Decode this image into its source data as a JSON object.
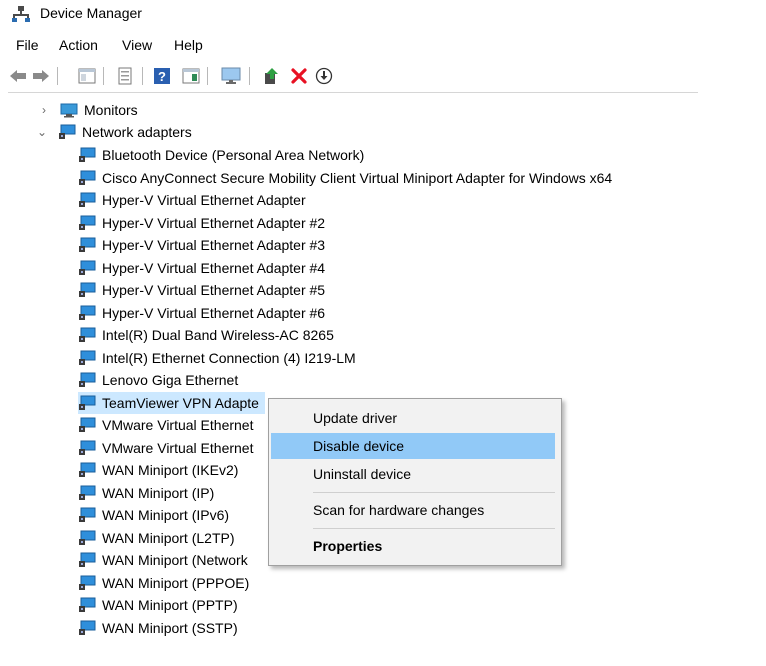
{
  "window": {
    "title": "Device Manager"
  },
  "menubar": [
    {
      "label": "File"
    },
    {
      "label": "Action"
    },
    {
      "label": "View"
    },
    {
      "label": "Help"
    }
  ],
  "toolbar": [
    {
      "icon": "back-arrow-icon"
    },
    {
      "icon": "forward-arrow-icon"
    },
    {
      "icon": "show-hide-console-tree-icon"
    },
    {
      "icon": "properties-icon"
    },
    {
      "icon": "help-icon"
    },
    {
      "icon": "action-pane-icon"
    },
    {
      "icon": "computer-monitor-icon"
    },
    {
      "icon": "update-driver-icon"
    },
    {
      "icon": "uninstall-x-icon"
    },
    {
      "icon": "download-circle-icon"
    }
  ],
  "tree": {
    "monitors": {
      "label": "Monitors",
      "expanded": false
    },
    "network_adapters": {
      "label": "Network adapters",
      "expanded": true,
      "children": [
        "Bluetooth Device (Personal Area Network)",
        "Cisco AnyConnect Secure Mobility Client Virtual Miniport Adapter for Windows x64",
        "Hyper-V Virtual Ethernet Adapter",
        "Hyper-V Virtual Ethernet Adapter #2",
        "Hyper-V Virtual Ethernet Adapter #3",
        "Hyper-V Virtual Ethernet Adapter #4",
        "Hyper-V Virtual Ethernet Adapter #5",
        "Hyper-V Virtual Ethernet Adapter #6",
        "Intel(R) Dual Band Wireless-AC 8265",
        "Intel(R) Ethernet Connection (4) I219-LM",
        "Lenovo Giga Ethernet",
        "TeamViewer VPN Adapte",
        "VMware Virtual Ethernet",
        "VMware Virtual Ethernet",
        "WAN Miniport (IKEv2)",
        "WAN Miniport (IP)",
        "WAN Miniport (IPv6)",
        "WAN Miniport (L2TP)",
        "WAN Miniport (Network",
        "WAN Miniport (PPPOE)",
        "WAN Miniport (PPTP)",
        "WAN Miniport (SSTP)"
      ],
      "selected_index": 11
    }
  },
  "context_menu": {
    "items": [
      {
        "label": "Update driver",
        "highlighted": false,
        "bold": false
      },
      {
        "label": "Disable device",
        "highlighted": true,
        "bold": false
      },
      {
        "label": "Uninstall device",
        "highlighted": false,
        "bold": false
      },
      {
        "label": "Scan for hardware changes",
        "highlighted": false,
        "bold": false
      },
      {
        "label": "Properties",
        "highlighted": false,
        "bold": true
      }
    ]
  },
  "colors": {
    "selection": "#cce8ff",
    "menu_highlight": "#91c9f7",
    "menu_bg": "#f2f2f2",
    "delete_red": "#e81123",
    "icon_blue": "#1e7bd6"
  }
}
